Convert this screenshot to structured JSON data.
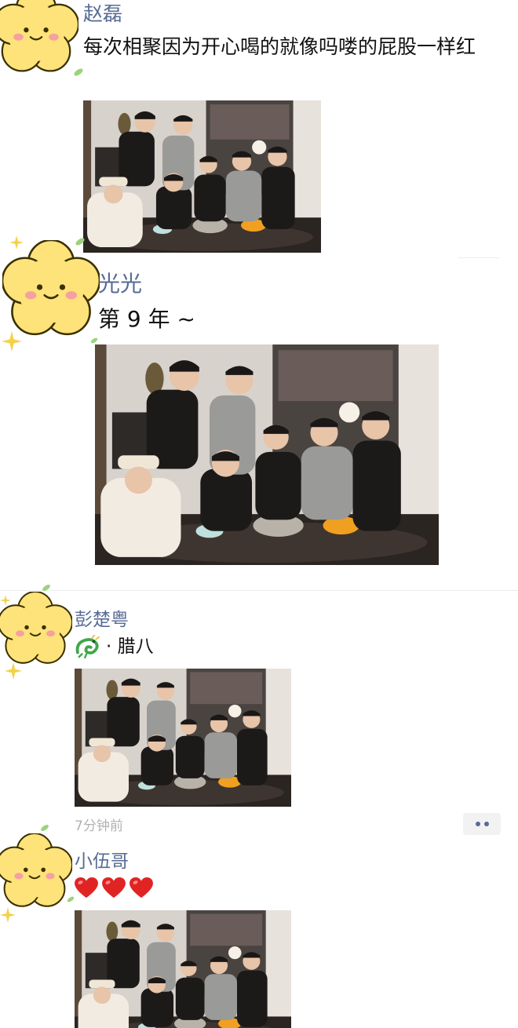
{
  "posts": [
    {
      "author": "赵磊",
      "text": "每次相聚因为开心喝的就像吗喽的屁股一样红"
    },
    {
      "author": "光光",
      "text": "第 9 年 ~"
    },
    {
      "author": "彭楚粤",
      "text": "· 腊八",
      "time": "7分钟前"
    },
    {
      "author": "小伍哥"
    }
  ],
  "colors": {
    "name": "#576b95",
    "avatar_yellow": "#fde37a",
    "avatar_outline": "#3b3000",
    "cheek": "#f6a0a0",
    "leaf": "#9bd37a",
    "time": "#b2b2b2",
    "heart": "#e02424"
  },
  "icons": {
    "avatar": "yellow-flower-smiley-icon",
    "dragon": "green-dragon-emoji-icon",
    "heart": "red-heart-emoji-icon",
    "more": "more-dots-icon"
  }
}
